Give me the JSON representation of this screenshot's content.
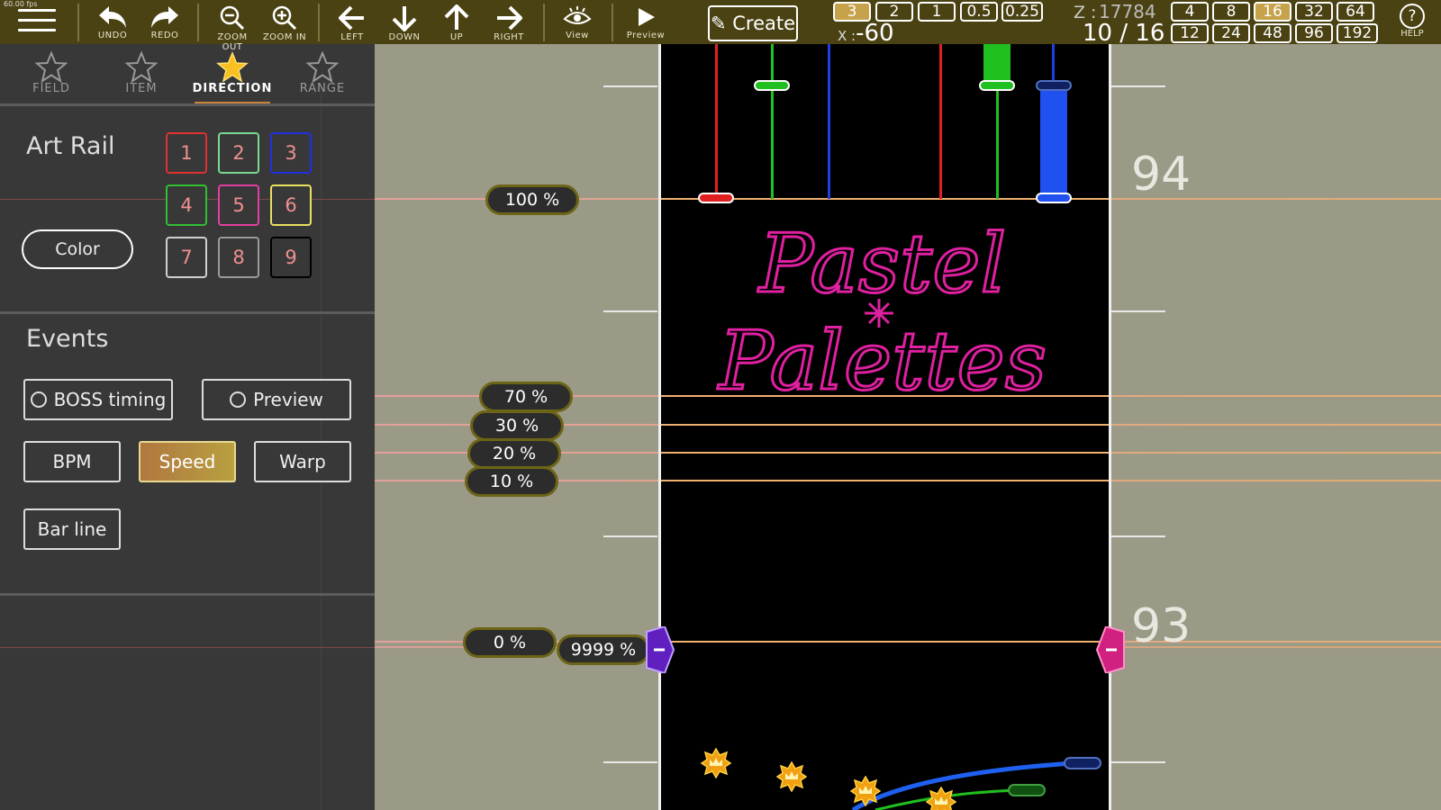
{
  "fps": "60.00 fps",
  "toolbar": {
    "undo": "UNDO",
    "redo": "REDO",
    "zoom_out": "ZOOM OUT",
    "zoom_in": "ZOOM IN",
    "left": "LEFT",
    "down": "DOWN",
    "up": "UP",
    "right": "RIGHT",
    "view": "View",
    "preview": "Preview",
    "create": "Create",
    "divisions": [
      "3",
      "2",
      "1",
      "0.5",
      "0.25"
    ],
    "active_division": "3",
    "x_label": "X :",
    "x_value": "-60",
    "z_label": "Z :",
    "z_value": "17784",
    "beat_current": "10",
    "beat_sep": "/",
    "beat_total": "16",
    "snap_top": [
      "4",
      "8",
      "16",
      "32",
      "64"
    ],
    "snap_bottom": [
      "12",
      "24",
      "48",
      "96",
      "192"
    ],
    "active_snap": "16",
    "help_icon": "?",
    "help": "HELP"
  },
  "tabs": [
    {
      "label": "FIELD",
      "icon": "star-outline-icon"
    },
    {
      "label": "ITEM",
      "icon": "star-outline-icon"
    },
    {
      "label": "DIRECTION",
      "icon": "star-filled-icon",
      "active": true
    },
    {
      "label": "RANGE",
      "icon": "star-outline-icon"
    }
  ],
  "art_rail": {
    "title": "Art Rail",
    "buttons": [
      {
        "label": "1",
        "border": "#e03030"
      },
      {
        "label": "2",
        "border": "#7ad890"
      },
      {
        "label": "3",
        "border": "#2030e0"
      },
      {
        "label": "4",
        "border": "#30c030"
      },
      {
        "label": "5",
        "border": "#e040a0"
      },
      {
        "label": "6",
        "border": "#e8e060"
      },
      {
        "label": "7",
        "border": "#d0d0d0"
      },
      {
        "label": "8",
        "border": "#9a9a9a"
      },
      {
        "label": "9",
        "border": "#000000"
      }
    ],
    "color_button": "Color"
  },
  "events": {
    "title": "Events",
    "boss_timing": "BOSS timing",
    "preview": "Preview",
    "bpm": "BPM",
    "speed": "Speed",
    "warp": "Warp",
    "bar_line": "Bar line"
  },
  "field": {
    "speed_labels": [
      "100 %",
      "70 %",
      "30 %",
      "20 %",
      "10 %",
      "0 %",
      "9999 %"
    ],
    "measures": [
      "94",
      "93"
    ],
    "logo_line1": "Pastel",
    "logo_line2": "Palettes",
    "colors": {
      "lane_bg": "#000000",
      "rail_red": "#e02020",
      "rail_green": "#20c020",
      "rail_blue": "#2040e0",
      "logo": "#e020a0",
      "marker_purple": "#6020c0",
      "marker_magenta": "#d02080"
    }
  }
}
